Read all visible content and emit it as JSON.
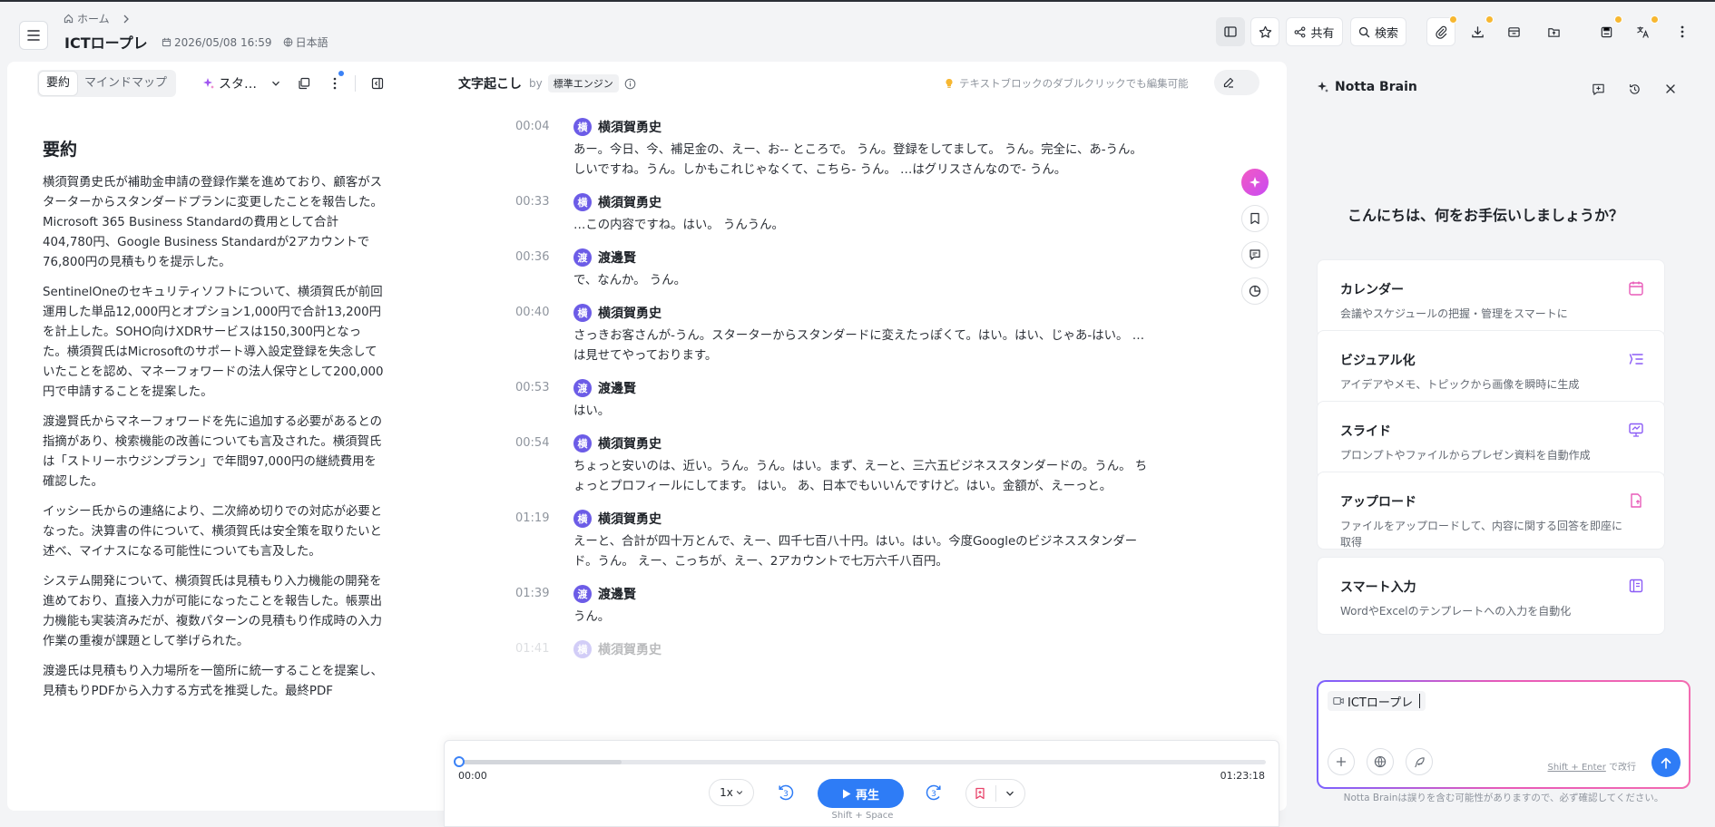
{
  "header": {
    "breadcrumb_home": "ホーム",
    "title": "ICTロープレ",
    "datetime": "2026/05/08 16:59",
    "language": "日本語",
    "share_label": "共有",
    "search_label": "検索"
  },
  "left": {
    "tabs": [
      "要約",
      "マインドマップ"
    ],
    "template_label": "スタ…",
    "summary_title": "要約",
    "summary_paragraphs": [
      "横須賀勇史氏が補助金申請の登録作業を進めており、顧客がスターターからスタンダードプランに変更したことを報告した。Microsoft 365 Business Standardの費用として合計404,780円、Google Business Standardが2アカウントで76,800円の見積もりを提示した。",
      "SentinelOneのセキュリティソフトについて、横須賀氏が前回運用した単品12,000円とオプション1,000円で合計13,200円を計上した。SOHO向けXDRサービスは150,300円となった。横須賀氏はMicrosoftのサポート導入設定登録を失念していたことを認め、マネーフォワードの法人保守として200,000円で申請することを提案した。",
      "渡邊賢氏からマネーフォワードを先に追加する必要があるとの指摘があり、検索機能の改善についても言及された。横須賀氏は「ストリーホウジンプラン」で年間97,000円の継続費用を確認した。",
      "イッシー氏からの連絡により、二次締め切りでの対応が必要となった。決算書の件について、横須賀氏は安全策を取りたいと述べ、マイナスになる可能性についても言及した。",
      "システム開発について、横須賀氏は見積もり入力機能の開発を進めており、直接入力が可能になったことを報告した。帳票出力機能も実装済みだが、複数パターンの見積もり作成時の入力作業の重複が課題として挙げられた。",
      "渡邊氏は見積もり入力場所を一箇所に統一することを提案し、見積もりPDFから入力する方式を推奨した。最終PDF"
    ]
  },
  "transcript": {
    "title": "文字起こし",
    "by": "by",
    "engine": "標準エンジン",
    "hint": "テキストブロックのダブルクリックでも編集可能",
    "segments": [
      {
        "time": "00:04",
        "initial": "横",
        "speaker": "横須賀勇史",
        "text": "あー。今日、今、補足金の、えー、お-- ところで。 うん。登録をしてまして。 うん。完全に、あ-うん。しいですね。うん。しかもこれじゃなくて、こちら- うん。 …はグリスさんなので- うん。"
      },
      {
        "time": "00:33",
        "initial": "横",
        "speaker": "横須賀勇史",
        "text": "…この内容ですね。はい。 うんうん。"
      },
      {
        "time": "00:36",
        "initial": "渡",
        "speaker": "渡邊賢",
        "text": "で、なんか。 うん。"
      },
      {
        "time": "00:40",
        "initial": "横",
        "speaker": "横須賀勇史",
        "text": "さっきお客さんが-うん。スターターからスタンダードに変えたっぽくて。はい。はい、じゃあ-はい。 …は見せてやっております。"
      },
      {
        "time": "00:53",
        "initial": "渡",
        "speaker": "渡邊賢",
        "text": "はい。"
      },
      {
        "time": "00:54",
        "initial": "横",
        "speaker": "横須賀勇史",
        "text": "ちょっと安いのは、近い。うん。うん。はい。まず、えーと、三六五ビジネススタンダードの。うん。 ちょっとプロフィールにしてます。 はい。 あ、日本でもいいんですけど。はい。金額が、えーっと。"
      },
      {
        "time": "01:19",
        "initial": "横",
        "speaker": "横須賀勇史",
        "text": "えーと、合計が四十万とんで、えー、四千七百八十円。はい。はい。今度Googleのビジネススタンダード。うん。 えー、こっちが、えー、2アカウントで七万六千八百円。"
      },
      {
        "time": "01:39",
        "initial": "渡",
        "speaker": "渡邊賢",
        "text": "うん。"
      },
      {
        "time": "01:41",
        "initial": "横",
        "speaker": "横須賀勇史",
        "text": ""
      }
    ]
  },
  "player": {
    "current": "00:00",
    "total": "01:23:18",
    "progress": 0,
    "speed": "1x",
    "skip_seconds": "3",
    "play_label": "再生",
    "shortcut": "Shift + Space"
  },
  "brain": {
    "title": "Notta Brain",
    "greeting": "こんにちは、何をお手伝いしましょうか？",
    "cards": [
      {
        "title": "カレンダー",
        "desc": "会議やスケジュールの把握・管理をスマートに",
        "icon": "calendar-icon",
        "color": "#e85ab8"
      },
      {
        "title": "ビジュアル化",
        "desc": "アイデアやメモ、トピックから画像を瞬時に生成",
        "icon": "visual-icon",
        "color": "#8b5cf6"
      },
      {
        "title": "スライド",
        "desc": "プロンプトやファイルからプレゼン資料を自動作成",
        "icon": "slide-icon",
        "color": "#8b5cf6"
      },
      {
        "title": "アップロード",
        "desc": "ファイルをアップロードして、内容に関する回答を即座に取得",
        "icon": "upload-icon",
        "color": "#e85ab8"
      },
      {
        "title": "スマート入力",
        "desc": "WordやExcelのテンプレートへの入力を自動化",
        "icon": "smart-input-icon",
        "color": "#8b5cf6"
      }
    ],
    "input_chip": "ICTロープレ",
    "enter_hint_key": "Shift + Enter",
    "enter_hint_text": "で改行",
    "disclaimer": "Notta Brainは誤りを含む可能性がありますので、必ず確認してください。"
  },
  "colors": {
    "accent": "#2e7cf6",
    "avatar": "#6c5ce7",
    "badge": "#f7b731"
  }
}
